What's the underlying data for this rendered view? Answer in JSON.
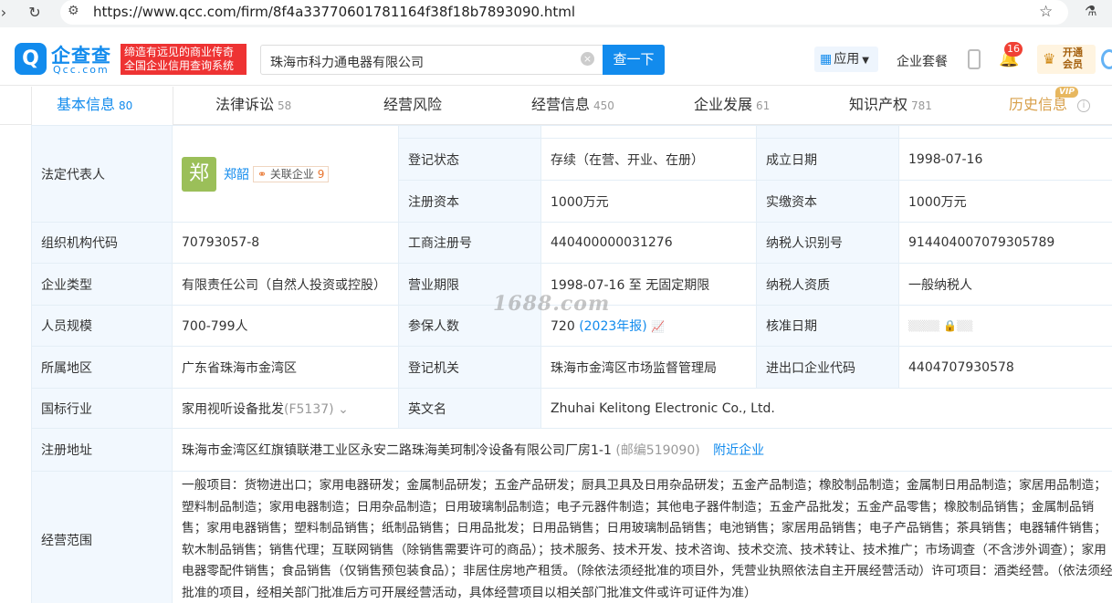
{
  "browser": {
    "url": "https://www.qcc.com/firm/8f4a33770601781164f38f18b7893090.html"
  },
  "header": {
    "logo_cn": "企查查",
    "logo_en": "Qcc.com",
    "slogan_line1": "缔造有远见的商业传奇",
    "slogan_line2": "全国企业信用查询系统",
    "search_value": "珠海市科力通电器有限公司",
    "search_button": "查一下",
    "app_label": "应用",
    "package_label": "企业套餐",
    "notification_count": "16",
    "vip_line1": "开通",
    "vip_line2": "会员"
  },
  "tabs": [
    {
      "label": "基本信息",
      "count": "80"
    },
    {
      "label": "法律诉讼",
      "count": "58"
    },
    {
      "label": "经营风险",
      "count": ""
    },
    {
      "label": "经营信息",
      "count": "450"
    },
    {
      "label": "企业发展",
      "count": "61"
    },
    {
      "label": "知识产权",
      "count": "781"
    },
    {
      "label": "历史信息",
      "count": ""
    }
  ],
  "vip_tag": "VIP",
  "company": {
    "legal_rep_label": "法定代表人",
    "legal_rep_avatar": "郑",
    "legal_rep_name": "郑韶",
    "related_label": "关联企业",
    "related_count": "9",
    "reg_status_label": "登记状态",
    "reg_status": "存续（在营、开业、在册）",
    "est_date_label": "成立日期",
    "est_date": "1998-07-16",
    "reg_capital_label": "注册资本",
    "reg_capital": "1000万元",
    "paid_capital_label": "实缴资本",
    "paid_capital": "1000万元",
    "org_code_label": "组织机构代码",
    "org_code": "70793057-8",
    "biz_reg_no_label": "工商注册号",
    "biz_reg_no": "440400000031276",
    "taxpayer_id_label": "纳税人识别号",
    "taxpayer_id": "914404007079305789",
    "company_type_label": "企业类型",
    "company_type": "有限责任公司（自然人投资或控股）",
    "biz_term_label": "营业期限",
    "biz_term": "1998-07-16 至 无固定期限",
    "taxpayer_qual_label": "纳税人资质",
    "taxpayer_qual": "一般纳税人",
    "staff_size_label": "人员规模",
    "staff_size": "700-799人",
    "insured_label": "参保人数",
    "insured_count": "720",
    "insured_report": "(2023年报)",
    "approval_date_label": "核准日期",
    "region_label": "所属地区",
    "region": "广东省珠海市金湾区",
    "reg_authority_label": "登记机关",
    "reg_authority": "珠海市金湾区市场监督管理局",
    "import_export_label": "进出口企业代码",
    "import_export_code": "4404707930578",
    "industry_label": "国标行业",
    "industry": "家用视听设备批发",
    "industry_code": "(F5137)",
    "english_name_label": "英文名",
    "english_name": "Zhuhai Kelitong Electronic Co., Ltd.",
    "address_label": "注册地址",
    "address": "珠海市金湾区红旗镇联港工业区永安二路珠海美珂制冷设备有限公司厂房1-1",
    "postcode": "(邮编519090)",
    "nearby_link": "附近企业",
    "scope_label": "经营范围",
    "scope": "一般项目：货物进出口；家用电器研发；金属制品研发；五金产品研发；厨具卫具及日用杂品研发；五金产品制造；橡胶制品制造；金属制日用品制造；家居用品制造；塑料制品制造；家用电器制造；日用杂品制造；日用玻璃制品制造；电子元器件制造；其他电子器件制造；五金产品批发；五金产品零售；橡胶制品销售；金属制品销售；家用电器销售；塑料制品销售；纸制品销售；日用品批发；日用品销售；日用玻璃制品销售；电池销售；家居用品销售；电子产品销售；茶具销售；电器辅件销售；软木制品销售；销售代理；互联网销售（除销售需要许可的商品）；技术服务、技术开发、技术咨询、技术交流、技术转让、技术推广；市场调查（不含涉外调查）；家用电器零配件销售；食品销售（仅销售预包装食品）；非居住房地产租赁。（除依法须经批准的项目外，凭营业执照依法自主开展经营活动）许可项目：酒类经营。（依法须经批准的项目，经相关部门批准后方可开展经营活动，具体经营项目以相关部门批准文件或许可证件为准）"
  },
  "watermark": "1688.com"
}
